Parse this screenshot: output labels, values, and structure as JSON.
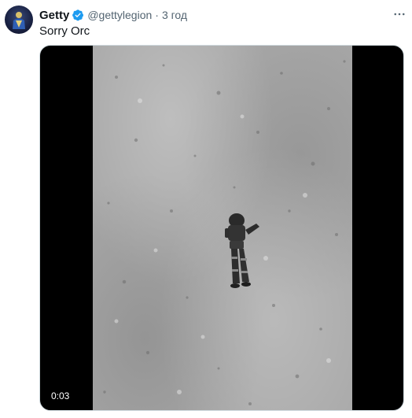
{
  "tweet": {
    "author_name": "Getty",
    "author_handle": "@gettylegion",
    "separator": "·",
    "time": "3 год",
    "text": "Sorry Orc",
    "verified_icon": "verified-badge-icon",
    "more_icon": "more-horizontal-icon"
  },
  "media": {
    "type": "video",
    "duration": "0:03"
  },
  "colors": {
    "verified": "#1d9bf0",
    "text_primary": "#0f1419",
    "text_secondary": "#536471"
  }
}
